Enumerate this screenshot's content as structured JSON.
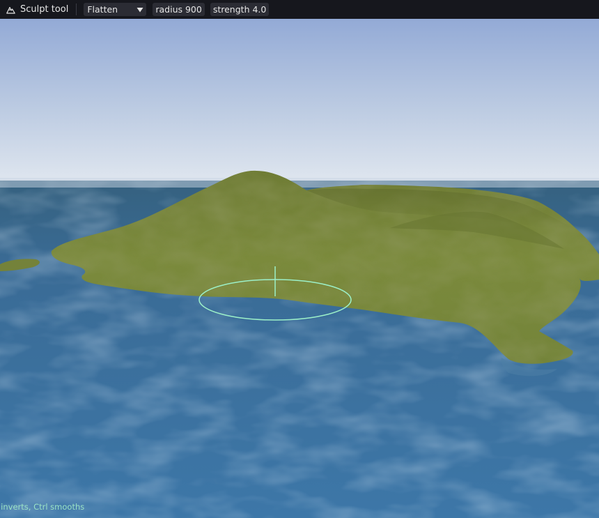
{
  "toolbar": {
    "icon": "mountain-icon",
    "title": "Sculpt tool",
    "mode": {
      "selected": "Flatten",
      "icon": "chevron-down-icon"
    },
    "radius_label": "radius 900",
    "strength_label": "strength 4.0"
  },
  "viewport": {
    "sky_top": "#95acd7",
    "sky_horizon": "#dde5ee",
    "water_color": "#3b6f9e",
    "terrain_color": "#75833a",
    "brush_color": "#9cf0c8"
  },
  "hint": "t inverts, Ctrl smooths"
}
